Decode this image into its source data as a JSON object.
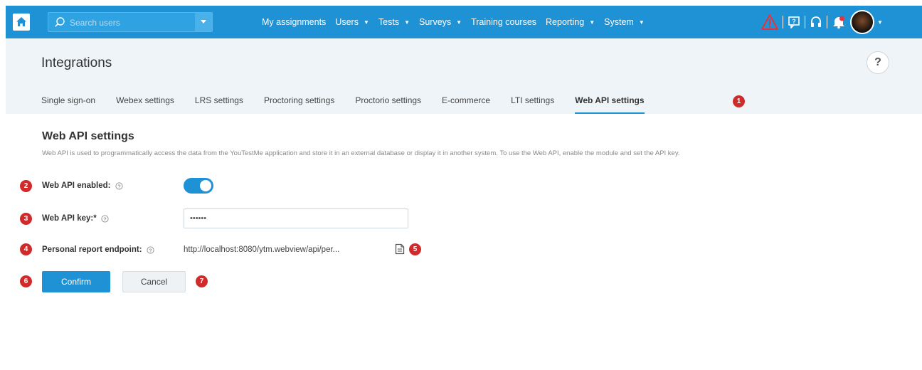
{
  "topbar": {
    "search_placeholder": "Search users",
    "nav": [
      {
        "label": "My assignments",
        "dropdown": false
      },
      {
        "label": "Users",
        "dropdown": true
      },
      {
        "label": "Tests",
        "dropdown": true
      },
      {
        "label": "Surveys",
        "dropdown": true
      },
      {
        "label": "Training courses",
        "dropdown": false
      },
      {
        "label": "Reporting",
        "dropdown": true
      },
      {
        "label": "System",
        "dropdown": true
      }
    ],
    "right_icons": [
      "warning-icon",
      "chat-icon",
      "headset-icon",
      "notification-icon"
    ]
  },
  "header": {
    "title": "Integrations",
    "help": "?",
    "tabs": [
      {
        "label": "Single sign-on",
        "active": false
      },
      {
        "label": "Webex settings",
        "active": false
      },
      {
        "label": "LRS settings",
        "active": false
      },
      {
        "label": "Proctoring settings",
        "active": false
      },
      {
        "label": "Proctorio settings",
        "active": false
      },
      {
        "label": "E-commerce",
        "active": false
      },
      {
        "label": "LTI settings",
        "active": false
      },
      {
        "label": "Web API settings",
        "active": true
      }
    ]
  },
  "content": {
    "title": "Web API settings",
    "description": "Web API is used to programmatically access the data from the YouTestMe application and store it in an external database or display it in another system. To use the Web API, enable the module and set the API key.",
    "enabled_label": "Web API enabled:",
    "enabled": true,
    "key_label": "Web API key:*",
    "key_value": "••••••",
    "endpoint_label": "Personal report endpoint:",
    "endpoint_value": "http://localhost:8080/ytm.webview/api/per..."
  },
  "buttons": {
    "confirm": "Confirm",
    "cancel": "Cancel"
  },
  "callouts": [
    "1",
    "2",
    "3",
    "4",
    "5",
    "6",
    "7"
  ],
  "colors": {
    "primary": "#1f92d6",
    "badge": "#d12a2a",
    "header_bg": "#eff4f8"
  }
}
